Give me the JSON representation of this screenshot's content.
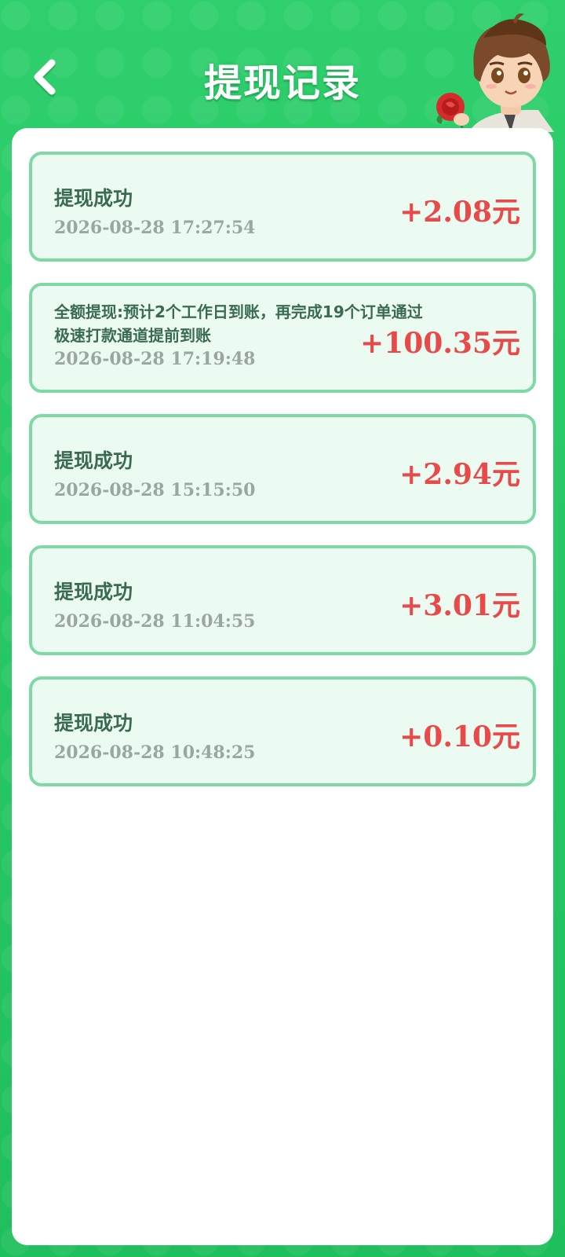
{
  "header": {
    "title": "提现记录",
    "back_icon": "chevron-left-icon",
    "mascot_icon": "mascot-avatar-icon"
  },
  "colors": {
    "background": "#2ecf6c",
    "card_background": "#ecfbf2",
    "card_border": "#7fd9a4",
    "amount": "#e84a4a",
    "title_text": "#3a6b52",
    "time_text": "#9aa7a0"
  },
  "records": [
    {
      "title": "提现成功",
      "time": "2026-08-28 17:27:54",
      "amount": "+2.08元"
    },
    {
      "title": "全额提现:预计2个工作日到账，再完成19个订单通过极速打款通道提前到账",
      "time": "2026-08-28 17:19:48",
      "amount": "+100.35元"
    },
    {
      "title": "提现成功",
      "time": "2026-08-28 15:15:50",
      "amount": "+2.94元"
    },
    {
      "title": "提现成功",
      "time": "2026-08-28 11:04:55",
      "amount": "+3.01元"
    },
    {
      "title": "提现成功",
      "time": "2026-08-28 10:48:25",
      "amount": "+0.10元"
    }
  ]
}
